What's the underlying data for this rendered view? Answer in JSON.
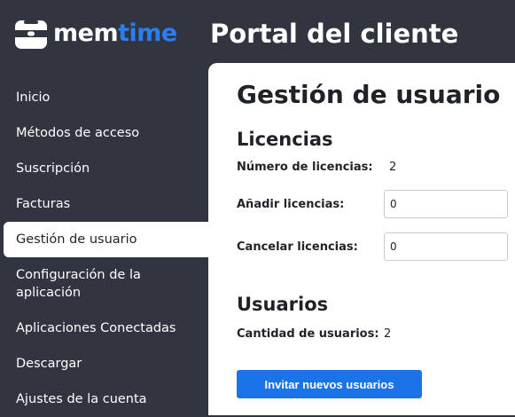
{
  "header": {
    "logo_part1": "mem",
    "logo_part2": "time",
    "title": "Portal del cliente",
    "accent_color": "#2b7df0"
  },
  "sidebar": {
    "items": [
      {
        "label": "Inicio"
      },
      {
        "label": "Métodos de acceso"
      },
      {
        "label": "Suscripción"
      },
      {
        "label": "Facturas"
      },
      {
        "label": "Gestión de usuario",
        "active": true
      },
      {
        "label": "Configuración de la aplicación"
      },
      {
        "label": "Aplicaciones Conectadas"
      },
      {
        "label": "Descargar"
      },
      {
        "label": "Ajustes de la cuenta"
      }
    ]
  },
  "main": {
    "page_title": "Gestión de usuario",
    "licenses": {
      "heading": "Licencias",
      "count_label": "Número de licencias:",
      "count_value": "2",
      "add_label": "Añadir licencias:",
      "add_value": "0",
      "cancel_label": "Cancelar licencias:",
      "cancel_value": "0"
    },
    "users": {
      "heading": "Usuarios",
      "count_label": "Cantidad de usuarios:",
      "count_value": "2",
      "invite_button": "Invitar nuevos usuarios"
    }
  },
  "icons": {
    "logo_icon": "memtime-logo-icon"
  }
}
